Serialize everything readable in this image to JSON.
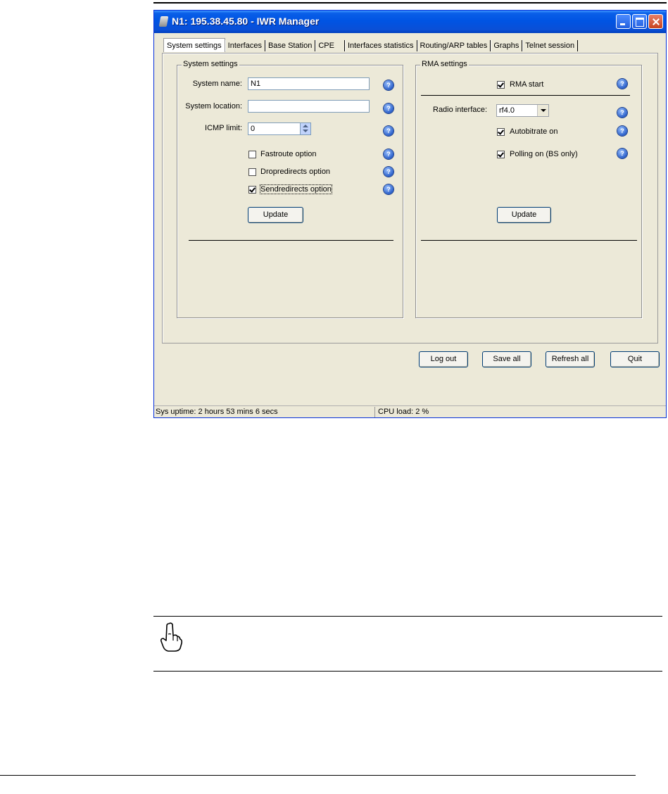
{
  "window": {
    "title": "N1: 195.38.45.80 - IWR Manager"
  },
  "tabs": [
    {
      "label": "System settings",
      "active": true
    },
    {
      "label": "Interfaces",
      "active": false
    },
    {
      "label": "Base Station",
      "active": false
    },
    {
      "label": "CPE",
      "active": false
    },
    {
      "label": "Interfaces statistics",
      "active": false
    },
    {
      "label": "Routing/ARP tables",
      "active": false
    },
    {
      "label": "Graphs",
      "active": false
    },
    {
      "label": "Telnet session",
      "active": false
    }
  ],
  "system_settings": {
    "group_title": "System settings",
    "system_name_label": "System name:",
    "system_name_value": "N1",
    "system_location_label": "System location:",
    "system_location_value": "",
    "icmp_limit_label": "ICMP limit:",
    "icmp_limit_value": "0",
    "options": [
      {
        "label": "Fastroute option",
        "checked": false
      },
      {
        "label": "Dropredirects option",
        "checked": false
      },
      {
        "label": "Sendredirects option",
        "checked": true
      }
    ],
    "update_label": "Update"
  },
  "rma_settings": {
    "group_title": "RMA settings",
    "rma_start_label": "RMA start",
    "rma_start_checked": true,
    "radio_interface_label": "Radio interface:",
    "radio_interface_value": "rf4.0",
    "autobitrate_label": "Autobitrate on",
    "autobitrate_checked": true,
    "polling_label": "Polling on (BS only)",
    "polling_checked": true,
    "update_label": "Update"
  },
  "help_glyph": "?",
  "footer_buttons": {
    "log_out": "Log out",
    "save_all": "Save all",
    "refresh_all": "Refresh all",
    "quit": "Quit"
  },
  "status": {
    "uptime": "Sys uptime: 2 hours 53 mins 6 secs",
    "cpu_load": "CPU load: 2 %"
  },
  "icons": {
    "app": "app-icon",
    "help": "help-icon",
    "note": "pointing-hand-icon"
  }
}
